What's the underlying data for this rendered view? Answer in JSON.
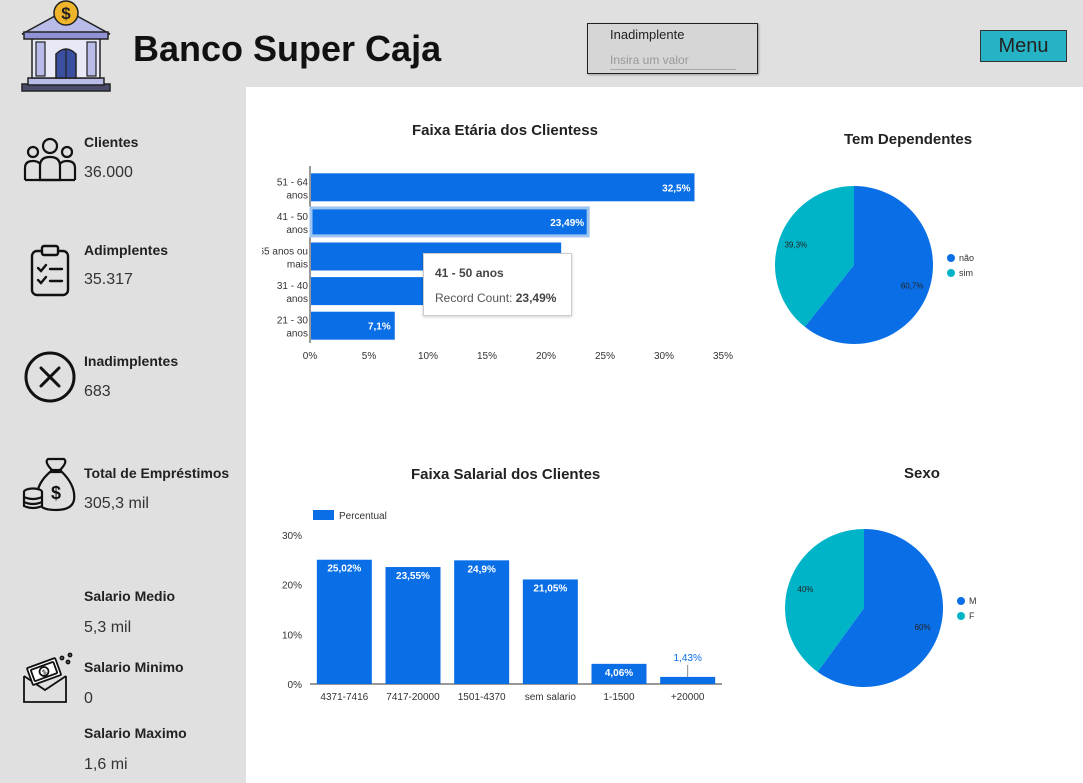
{
  "header": {
    "title": "Banco Super Caja",
    "filter_label": "Inadimplente",
    "filter_placeholder": "Insira um valor",
    "menu_label": "Menu",
    "logo_icon": "bank-icon"
  },
  "kpis": [
    {
      "icon": "users-icon",
      "label": "Clientes",
      "value": "36.000"
    },
    {
      "icon": "clipboard-check-icon",
      "label": "Adimplentes",
      "value": "35.317"
    },
    {
      "icon": "x-circle-icon",
      "label": "Inadimplentes",
      "value": "683"
    },
    {
      "icon": "money-bag-icon",
      "label": "Total de Empréstimos",
      "value": "305,3 mil"
    }
  ],
  "salary": {
    "icon": "money-envelope-icon",
    "medio_label": "Salario Medio",
    "medio_value": "5,3 mil",
    "minimo_label": "Salario Minimo",
    "minimo_value": "0",
    "maximo_label": "Salario Maximo",
    "maximo_value": "1,6 mi"
  },
  "tooltip": {
    "title": "41 - 50 anos",
    "metric_label": "Record Count:",
    "metric_value": "23,49%"
  },
  "colors": {
    "primary": "#0a6fe6",
    "secondary": "#00b4c8"
  },
  "chart_data": [
    {
      "type": "bar",
      "orientation": "horizontal",
      "title": "Faixa Etária dos Clientess",
      "categories": [
        "51 - 64 anos",
        "41 - 50 anos",
        "65 anos ou mais",
        "31 - 40 anos",
        "21 - 30 anos"
      ],
      "values": [
        32.5,
        23.49,
        21.2,
        19.0,
        7.1
      ],
      "data_labels": [
        "32,5%",
        "23,49%",
        "",
        "",
        "7,1%"
      ],
      "xlim": [
        0,
        35
      ],
      "ticks": [
        "0%",
        "5%",
        "10%",
        "15%",
        "20%",
        "25%",
        "30%",
        "35%"
      ]
    },
    {
      "type": "bar",
      "title": "Faixa Salarial dos Clientes",
      "legend": "Percentual",
      "categories": [
        "4371-7416",
        "7417-20000",
        "1501-4370",
        "sem salario",
        "1-1500",
        "+20000"
      ],
      "values": [
        25.02,
        23.55,
        24.9,
        21.05,
        4.06,
        1.43
      ],
      "data_labels": [
        "25,02%",
        "23,55%",
        "24,9%",
        "21,05%",
        "4,06%",
        "1,43%"
      ],
      "ylim": [
        0,
        30
      ],
      "ticks": [
        "0%",
        "10%",
        "20%",
        "30%"
      ]
    },
    {
      "type": "pie",
      "title": "Tem Dependentes",
      "labels": [
        "não",
        "sim"
      ],
      "values": [
        60.7,
        39.3
      ],
      "data_labels": [
        "60,7%",
        "39,3%"
      ],
      "legend": "right"
    },
    {
      "type": "pie",
      "title": "Sexo",
      "labels": [
        "M",
        "F"
      ],
      "values": [
        60,
        40
      ],
      "data_labels": [
        "60%",
        "40%"
      ],
      "legend": "right"
    }
  ]
}
